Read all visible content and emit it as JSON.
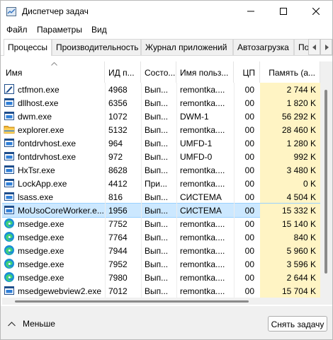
{
  "window": {
    "title": "Диспетчер задач"
  },
  "menu": [
    "Файл",
    "Параметры",
    "Вид"
  ],
  "tabs": [
    {
      "label": "Процессы",
      "active": true
    },
    {
      "label": "Производительность",
      "active": false
    },
    {
      "label": "Журнал приложений",
      "active": false
    },
    {
      "label": "Автозагрузка",
      "active": false
    },
    {
      "label": "По",
      "active": false
    }
  ],
  "columns": {
    "name": "Имя",
    "pid": "ИД п...",
    "status": "Состо...",
    "user": "Имя польз...",
    "cpu": "ЦП",
    "memory": "Память (а..."
  },
  "rows": [
    {
      "icon": "ctfmon-icon",
      "name": "ctfmon.exe",
      "pid": "4968",
      "status": "Вып...",
      "user": "remontka....",
      "cpu": "00",
      "memory": "2 744 K"
    },
    {
      "icon": "app-window-icon",
      "name": "dllhost.exe",
      "pid": "6356",
      "status": "Вып...",
      "user": "remontka....",
      "cpu": "00",
      "memory": "1 820 K"
    },
    {
      "icon": "app-window-icon",
      "name": "dwm.exe",
      "pid": "1072",
      "status": "Вып...",
      "user": "DWM-1",
      "cpu": "00",
      "memory": "56 292 K"
    },
    {
      "icon": "folder-icon",
      "name": "explorer.exe",
      "pid": "5132",
      "status": "Вып...",
      "user": "remontka....",
      "cpu": "00",
      "memory": "28 460 K"
    },
    {
      "icon": "app-window-icon",
      "name": "fontdrvhost.exe",
      "pid": "964",
      "status": "Вып...",
      "user": "UMFD-1",
      "cpu": "00",
      "memory": "1 280 K"
    },
    {
      "icon": "app-window-icon",
      "name": "fontdrvhost.exe",
      "pid": "972",
      "status": "Вып...",
      "user": "UMFD-0",
      "cpu": "00",
      "memory": "992 K"
    },
    {
      "icon": "app-window-icon",
      "name": "HxTsr.exe",
      "pid": "8628",
      "status": "Вып...",
      "user": "remontka....",
      "cpu": "00",
      "memory": "3 480 K"
    },
    {
      "icon": "app-window-icon",
      "name": "LockApp.exe",
      "pid": "4412",
      "status": "При...",
      "user": "remontka....",
      "cpu": "00",
      "memory": "0 K"
    },
    {
      "icon": "app-window-icon",
      "name": "lsass.exe",
      "pid": "816",
      "status": "Вып...",
      "user": "СИСТЕМА",
      "cpu": "00",
      "memory": "4 504 K"
    },
    {
      "icon": "app-window-icon",
      "name": "MoUsoCoreWorker.e...",
      "pid": "1956",
      "status": "Вып...",
      "user": "СИСТЕМА",
      "cpu": "00",
      "memory": "15 332 K",
      "selected": true
    },
    {
      "icon": "edge-icon",
      "name": "msedge.exe",
      "pid": "7752",
      "status": "Вып...",
      "user": "remontka....",
      "cpu": "00",
      "memory": "15 140 K"
    },
    {
      "icon": "edge-icon",
      "name": "msedge.exe",
      "pid": "7764",
      "status": "Вып...",
      "user": "remontka....",
      "cpu": "00",
      "memory": "840 K"
    },
    {
      "icon": "edge-icon",
      "name": "msedge.exe",
      "pid": "7944",
      "status": "Вып...",
      "user": "remontka....",
      "cpu": "00",
      "memory": "5 960 K"
    },
    {
      "icon": "edge-icon",
      "name": "msedge.exe",
      "pid": "7952",
      "status": "Вып...",
      "user": "remontka....",
      "cpu": "00",
      "memory": "3 596 K"
    },
    {
      "icon": "edge-icon",
      "name": "msedge.exe",
      "pid": "7980",
      "status": "Вып...",
      "user": "remontka....",
      "cpu": "00",
      "memory": "2 644 K"
    },
    {
      "icon": "app-window-icon",
      "name": "msedgewebview2.exe",
      "pid": "7012",
      "status": "Вып...",
      "user": "remontka....",
      "cpu": "00",
      "memory": "15 704 K"
    }
  ],
  "footer": {
    "less_label": "Меньше",
    "end_task_label": "Снять задачу"
  },
  "colors": {
    "selection": "#cce8ff",
    "memory_highlight": "#fff4c4",
    "accent": "#0067c0"
  }
}
